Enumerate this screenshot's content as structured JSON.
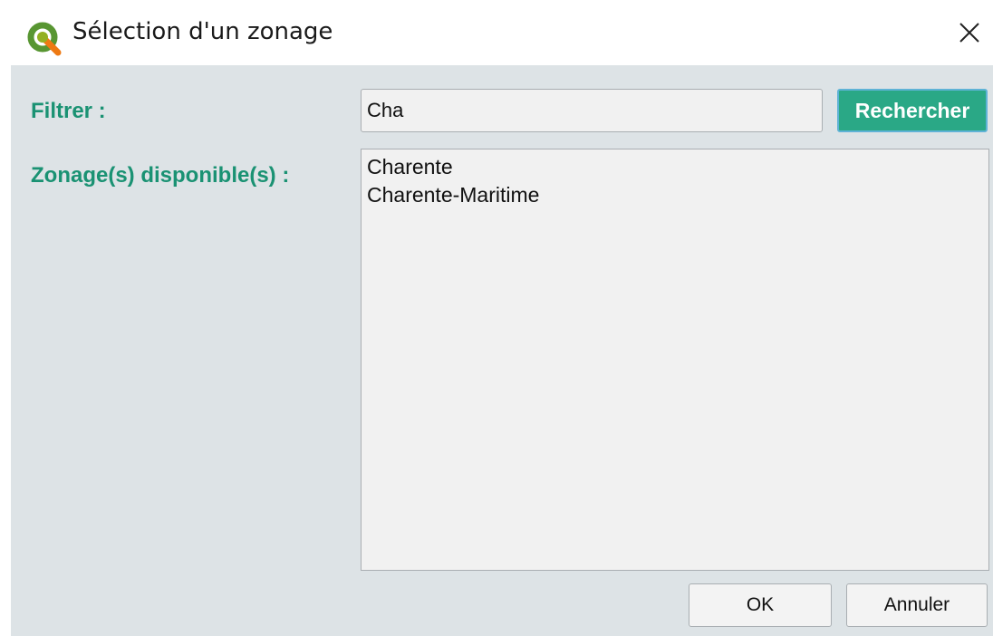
{
  "window": {
    "title": "Sélection d'un zonage",
    "icon": "qgis-logo-icon",
    "close_icon": "close-icon"
  },
  "form": {
    "filter_label": "Filtrer :",
    "filter_value": "Cha",
    "search_button": "Rechercher",
    "zonages_label": "Zonage(s) disponible(s) :",
    "zonages": [
      {
        "label": "Charente"
      },
      {
        "label": "Charente-Maritime"
      }
    ]
  },
  "actions": {
    "ok": "OK",
    "cancel": "Annuler"
  },
  "colors": {
    "accent_label": "#1a9273",
    "search_button_bg": "#2aa886",
    "panel_bg": "#dde3e6"
  }
}
